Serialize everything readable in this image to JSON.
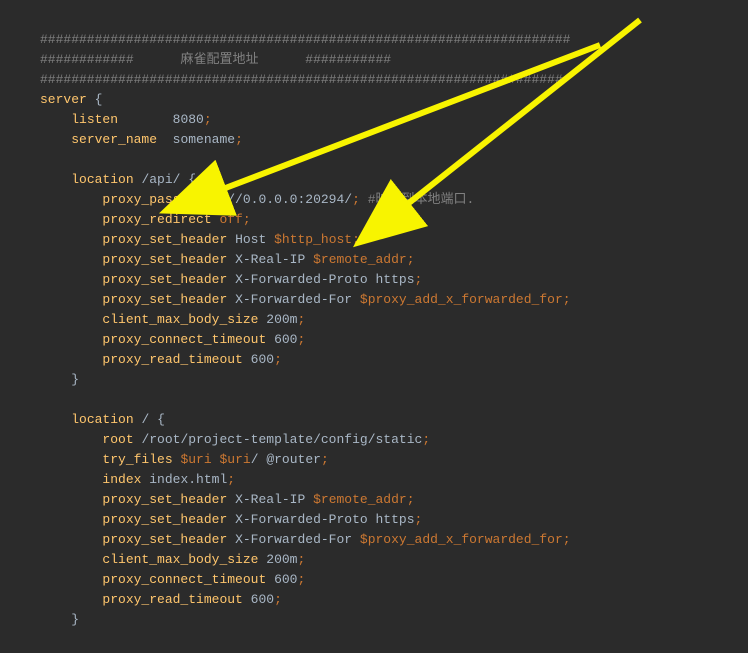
{
  "code": {
    "hashline1": "####################################################################",
    "hashline2_prefix": "############",
    "comment_zh": "麻雀配置地址",
    "hashline2_suffix": "###########",
    "hashline3": "###################################################################",
    "server": "server",
    "brace_open": "{",
    "brace_close": "}",
    "listen": "listen",
    "listen_val": "8080",
    "server_name": "server_name",
    "server_name_val": "somename",
    "location": "location",
    "loc_api": "/api/",
    "proxy_pass": "proxy_pass",
    "proxy_pass_val": "http://0.0.0.0:20294/",
    "proxy_pass_comment": "#映射到本地端口.",
    "proxy_redirect": "proxy_redirect",
    "off": "off",
    "proxy_set_header": "proxy_set_header",
    "host": "Host",
    "http_host": "$http_host",
    "x_real_ip": "X-Real-IP",
    "remote_addr": "$remote_addr",
    "x_fwd_proto": "X-Forwarded-Proto",
    "https": "https",
    "x_fwd_for": "X-Forwarded-For",
    "proxy_add_fwd": "$proxy_add_x_forwarded_for",
    "client_max_body": "client_max_body_size",
    "size_200m": "200m",
    "proxy_connect_timeout": "proxy_connect_timeout",
    "proxy_read_timeout": "proxy_read_timeout",
    "timeout_600": "600",
    "loc_root": "/",
    "root": "root",
    "root_val": "/root/project-template/config/static",
    "try_files": "try_files",
    "uri": "$uri",
    "uri_slash": "/",
    "at_router": "@router",
    "index": "index",
    "index_val": "index.html"
  }
}
